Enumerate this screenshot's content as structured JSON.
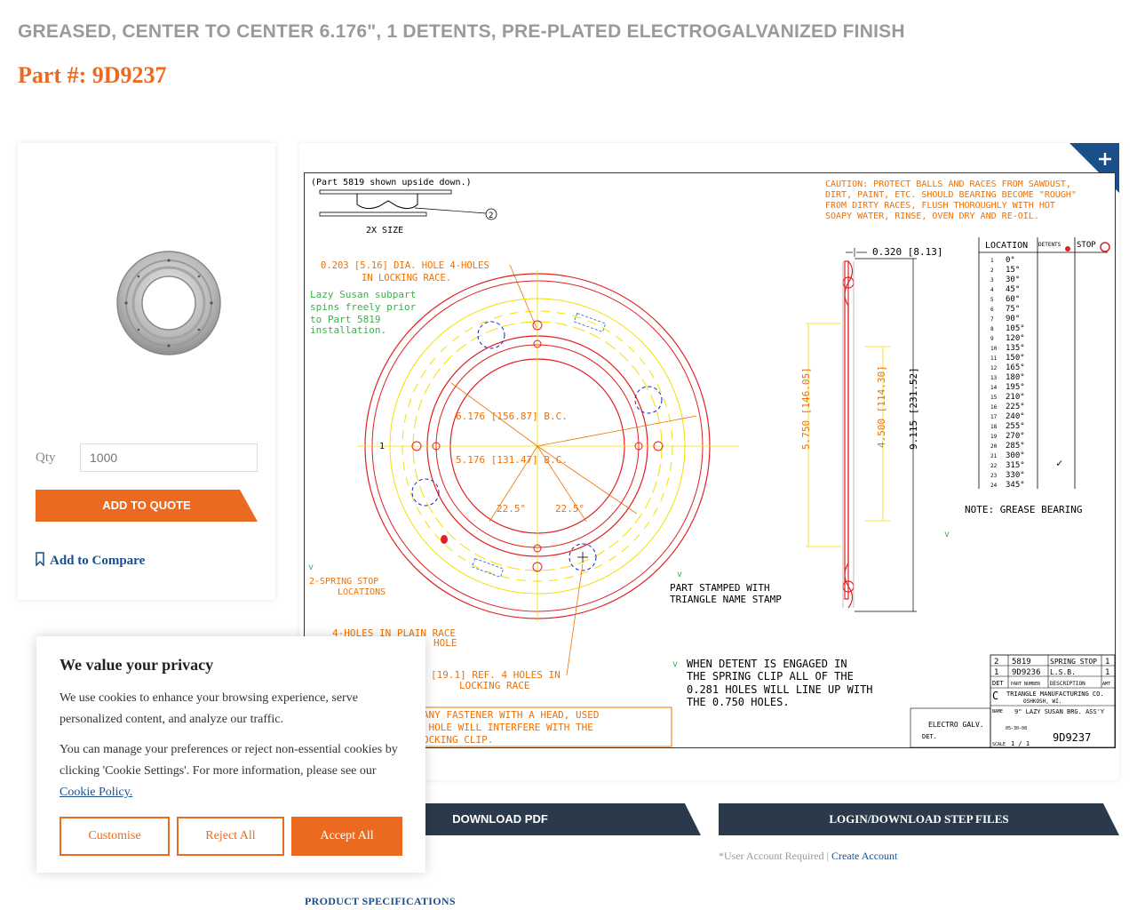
{
  "product": {
    "title": "GREASED, CENTER TO CENTER 6.176\", 1 DETENTS, PRE-PLATED ELECTROGALVANIZED FINISH",
    "part_number": "Part #: 9D9237"
  },
  "purchase": {
    "qty_label": "Qty",
    "qty_placeholder": "1000",
    "add_to_quote": "ADD TO QUOTE",
    "add_to_compare": "Add to Compare"
  },
  "drawing": {
    "zoom_icon": "plus-icon",
    "header_note": "(Part 5819 shown upside down.)",
    "size_note": "2X SIZE",
    "callout_2": "2",
    "caution": [
      "CAUTION: PROTECT BALLS AND RACES FROM SAWDUST,",
      "DIRT, PAINT, ETC. SHOULD BEARING BECOME \"ROUGH\"",
      "FROM DIRTY RACES, FLUSH THOROUGHLY WITH HOT",
      "SOAPY WATER, RINSE, OVEN DRY AND RE-OIL."
    ],
    "hole_note": [
      "0.203 [5.16] DIA. HOLE 4-HOLES",
      "IN LOCKING RACE."
    ],
    "lazy_note": [
      "Lazy Susan subpart",
      "spins freely prior",
      "to Part 5819",
      "installation."
    ],
    "bc1": "6.176 [156.87] B.C.",
    "bc2": "5.176 [131.47] B.C.",
    "angle1": "22.5°",
    "angle2": "22.5°",
    "pos_mark": "1",
    "spring_stop": [
      "2-SPRING STOP",
      "LOCATIONS"
    ],
    "plain_race": [
      "4-HOLES IN PLAIN RACE",
      "HOLE"
    ],
    "ref_holes": [
      "[19.1] REF. 4 HOLES IN",
      "LOCKING RACE"
    ],
    "warning": [
      "G: ANY FASTENER WITH A HEAD, USED",
      "281 HOLE WILL INTERFERE WITH THE",
      "C LOCKING CLIP."
    ],
    "thickness": "0.320 [8.13]",
    "dim1": "5.750 [146.05]",
    "dim2": "4.500 [114.30]",
    "dim3": "9.115 [231.52]",
    "stamped": [
      "PART STAMPED WITH",
      "TRIANGLE NAME STAMP"
    ],
    "detent_note": [
      "WHEN DETENT IS ENGAGED IN",
      "THE SPRING CLIP ALL OF THE",
      "0.281 HOLES WILL LINE UP WITH",
      "THE 0.750 HOLES."
    ],
    "grease_note": "NOTE: GREASE BEARING",
    "loc_headers": [
      "LOCATION",
      "DETENTS",
      "STOP"
    ],
    "loc_rows": [
      [
        "1",
        "0°"
      ],
      [
        "2",
        "15°"
      ],
      [
        "3",
        "30°"
      ],
      [
        "4",
        "45°"
      ],
      [
        "5",
        "60°"
      ],
      [
        "6",
        "75°"
      ],
      [
        "7",
        "90°"
      ],
      [
        "8",
        "105°"
      ],
      [
        "9",
        "120°"
      ],
      [
        "10",
        "135°"
      ],
      [
        "11",
        "150°"
      ],
      [
        "12",
        "165°"
      ],
      [
        "13",
        "180°"
      ],
      [
        "14",
        "195°"
      ],
      [
        "15",
        "210°"
      ],
      [
        "16",
        "225°"
      ],
      [
        "17",
        "240°"
      ],
      [
        "18",
        "255°"
      ],
      [
        "19",
        "270°"
      ],
      [
        "20",
        "285°"
      ],
      [
        "21",
        "300°"
      ],
      [
        "22",
        "315°"
      ],
      [
        "23",
        "330°"
      ],
      [
        "24",
        "345°"
      ]
    ],
    "check_mark": "✓",
    "bom": {
      "rows": [
        [
          "2",
          "5819",
          "SPRING STOP",
          "1"
        ],
        [
          "1",
          "9D9236",
          "L.S.B.",
          "1"
        ]
      ],
      "headers": [
        "DET",
        "PART NUMBER",
        "DESCRIPTION",
        "AMT"
      ],
      "company": [
        "TRIANGLE MANUFACTURING CO.",
        "OSHKOSH, WI."
      ],
      "name_label": "NAME",
      "name": "9\" LAZY SUSAN BRG. ASS'Y",
      "finish": "ELECTRO GALV.",
      "size": "DET.",
      "scale_label": "SCALE",
      "scale": "1 / 1",
      "drawing_no": "9D9237",
      "date": "05-30-08"
    }
  },
  "actions": {
    "download_pdf": "DOWNLOAD PDF",
    "login_step": "LOGIN/DOWNLOAD STEP FILES",
    "account_note": "*User Account Required | ",
    "create_account": "Create Account",
    "spec_tab": "PRODUCT SPECIFICATIONS"
  },
  "cookie": {
    "title": "We value your privacy",
    "p1": "We use cookies to enhance your browsing experience, serve personalized content, and analyze our traffic.",
    "p2": "You can manage your preferences or reject non-essential cookies by clicking 'Cookie Settings'. For more information, please see our",
    "policy_link": "Cookie Policy.",
    "customise": "Customise",
    "reject": "Reject All",
    "accept": "Accept All"
  },
  "colors": {
    "accent": "#ec6a1f",
    "navy": "#2b3a4a",
    "link": "#1a4f8a"
  }
}
